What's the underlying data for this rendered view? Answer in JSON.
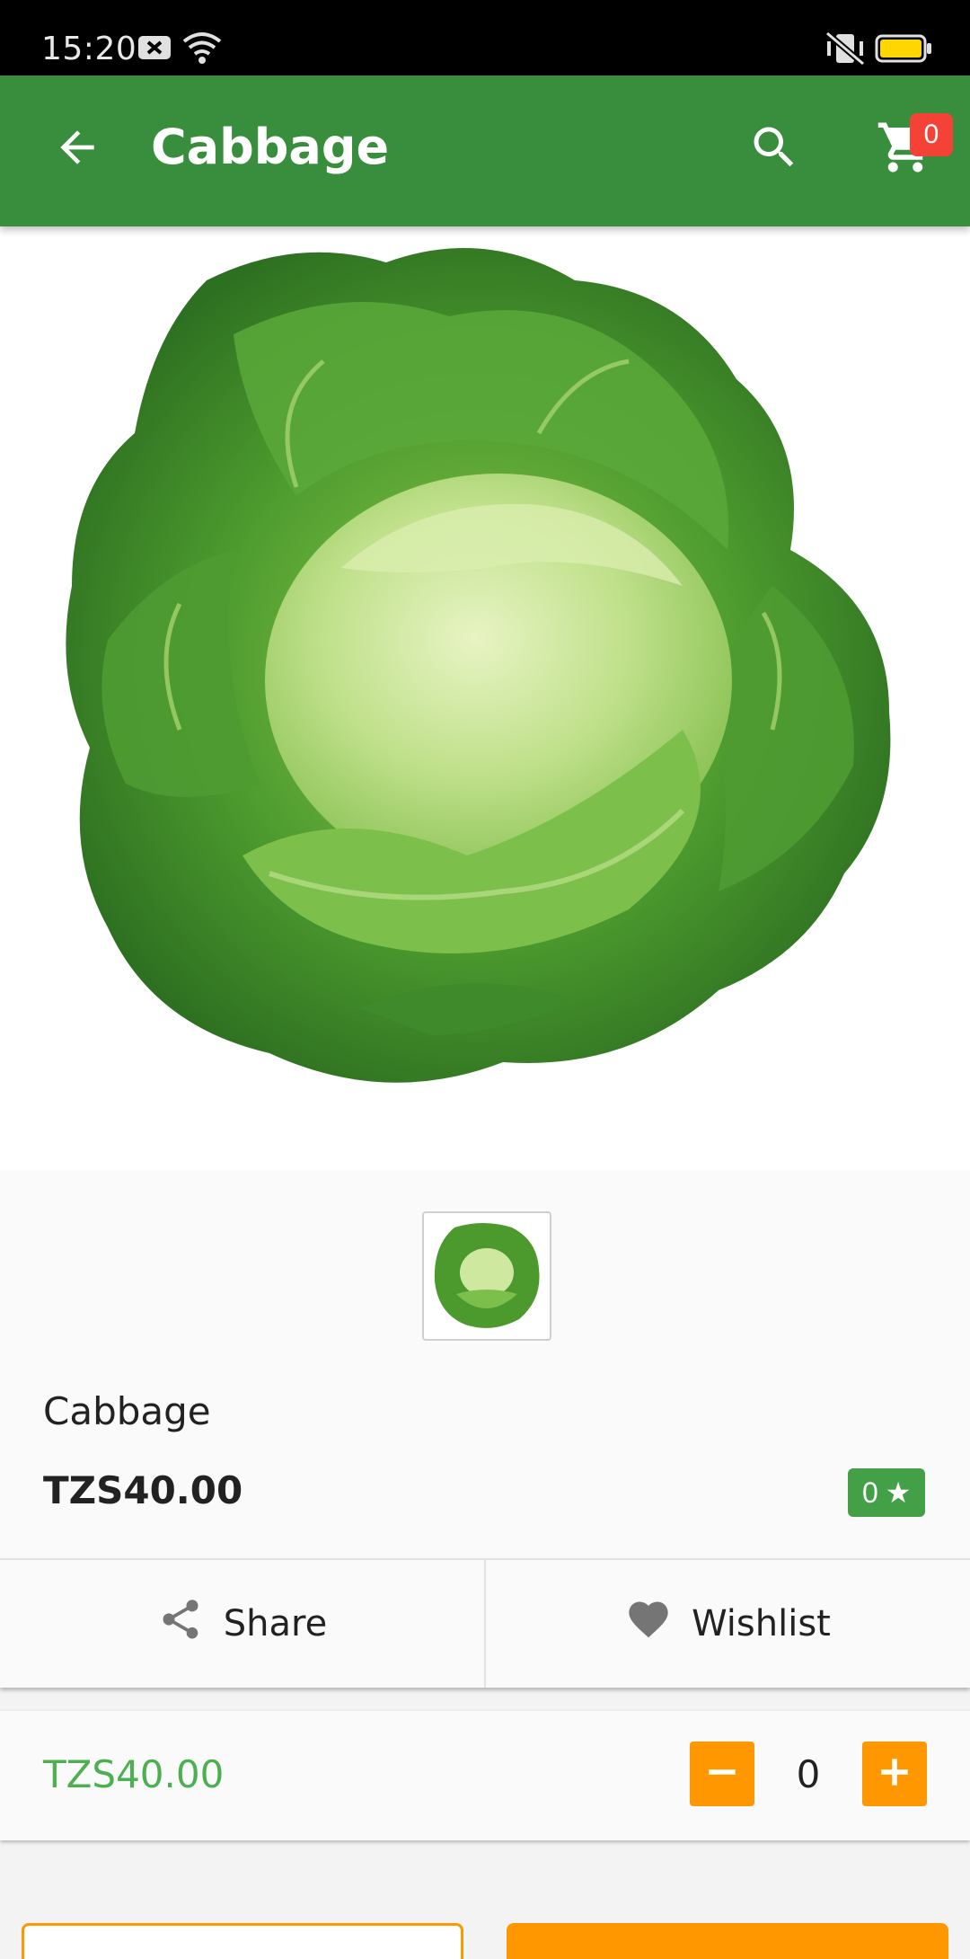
{
  "status_bar": {
    "time": "15:20",
    "icons": [
      "notification-x-icon",
      "wifi-icon",
      "vibrate-icon",
      "battery-icon"
    ]
  },
  "app_bar": {
    "title": "Cabbage",
    "cart_count": "0",
    "icons": [
      "back-arrow-icon",
      "search-icon",
      "cart-icon"
    ],
    "color": "#388e3c"
  },
  "product": {
    "name": "Cabbage",
    "price": "TZS40.00",
    "rating": "0",
    "rating_icon": "star-icon"
  },
  "actions": {
    "share_label": "Share",
    "wishlist_label": "Wishlist"
  },
  "purchase": {
    "price": "TZS40.00",
    "quantity": "0",
    "accent": "#ff9800"
  }
}
